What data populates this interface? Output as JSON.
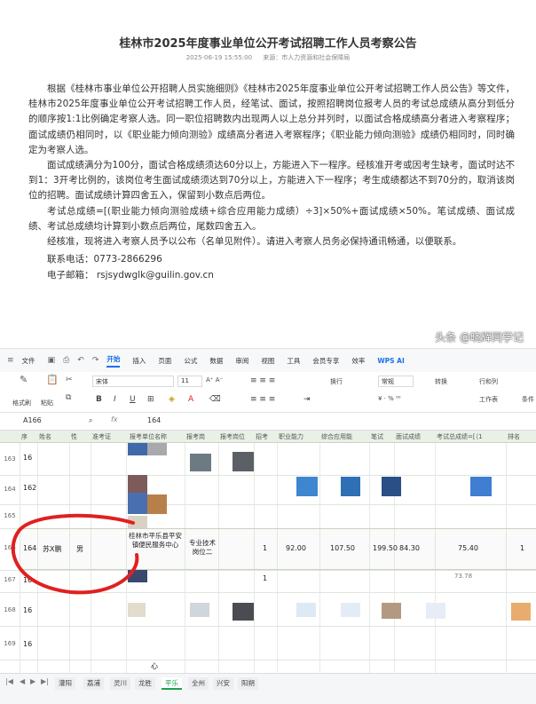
{
  "article": {
    "title": "桂林市2025年度事业单位公开考试招聘工作人员考察公告",
    "date": "2025-06-19 15:55:00",
    "source": "来源：市人力资源和社会保障局",
    "paragraphs": [
      "根据《桂林市事业单位公开招聘人员实施细则》《桂林市2025年度事业单位公开考试招聘工作人员公告》等文件，桂林市2025年度事业单位公开考试招聘工作人员，经笔试、面试，按照招聘岗位报考人员的考试总成绩从高分到低分的顺序按1:1比例确定考察人选。同一职位招聘数内出现两人以上总分并列时，以面试合格成绩高分者进入考察程序；面试成绩仍相同时，以《职业能力倾向测验》成绩高分者进入考察程序；《职业能力倾向测验》成绩仍相同时，同时确定为考察人选。",
      "面试成绩满分为100分，面试合格成绩须达60分以上，方能进入下一程序。经核准开考或因考生缺考，面试时达不到1：3开考比例的，该岗位考生面试成绩须达到70分以上，方能进入下一程序；考生成绩都达不到70分的，取消该岗位的招聘。面试成绩计算四舍五入，保留到小数点后两位。",
      "考试总成绩=[(职业能力倾向测验成绩+综合应用能力成绩）÷3]×50%+面试成绩×50%。笔试成绩、面试成绩、考试总成绩均计算到小数点后两位，尾数四舍五入。",
      "经核准，现将进入考察人员予以公布（名单见附件）。请进入考察人员务必保持通讯畅通，以便联系。"
    ],
    "phone": "联系电话：0773-2866296",
    "email": "电子邮箱：  rsjsydwglk@guilin.gov.cn"
  },
  "menubar": {
    "file": "文件",
    "items": [
      "开始",
      "插入",
      "页面",
      "公式",
      "数据",
      "审阅",
      "视图",
      "工具",
      "会员专享",
      "效率"
    ],
    "active": "开始",
    "wps_ai": "WPS AI"
  },
  "ribbon": {
    "format_painter": "格式刷",
    "paste": "粘贴",
    "font": "宋体",
    "size": "11",
    "wrap": "换行",
    "number_format": "常规",
    "convert": "转换",
    "rows_cols": "行和列",
    "worksheet": "工作表",
    "cond": "条件"
  },
  "formulabar": {
    "cell_ref": "A166",
    "fx": "fx",
    "value": "164"
  },
  "grid": {
    "headers": [
      "序",
      "姓名",
      "性",
      "准考证",
      "报考单位名称",
      "报考岗",
      "报考岗位",
      "招考",
      "职业能力",
      "综合应用能",
      "笔试",
      "面试成绩",
      "考试总成绩=[（1",
      "排名"
    ],
    "row_numbers": [
      "163",
      "164",
      "165",
      "166",
      "167",
      "168",
      "169"
    ],
    "partial_cells": [
      "16",
      "162",
      "16",
      "16",
      "16"
    ],
    "highlight_row": {
      "seq": "164",
      "name": "苏X鹏",
      "gender": "男",
      "unit": "桂林市平乐县平安镇便民服务中心",
      "post": "专业技术岗位二",
      "quota": "1",
      "aptitude": "92.00",
      "comprehensive": "107.50",
      "written": "199.50",
      "interview": "84.30",
      "total": "75.40",
      "rank": "1"
    },
    "extra": [
      "1",
      "73.78",
      "心"
    ]
  },
  "tabs": [
    "灌阳",
    "荔浦",
    "灵川",
    "龙胜",
    "平乐",
    "全州",
    "兴安",
    "阳朔"
  ],
  "active_tab": "平乐",
  "watermark": "头条 @晓辉同学记",
  "colors": {
    "accent": "#1a73e8",
    "sheet_green": "#1aa34a",
    "annotation_red": "#e02020"
  }
}
